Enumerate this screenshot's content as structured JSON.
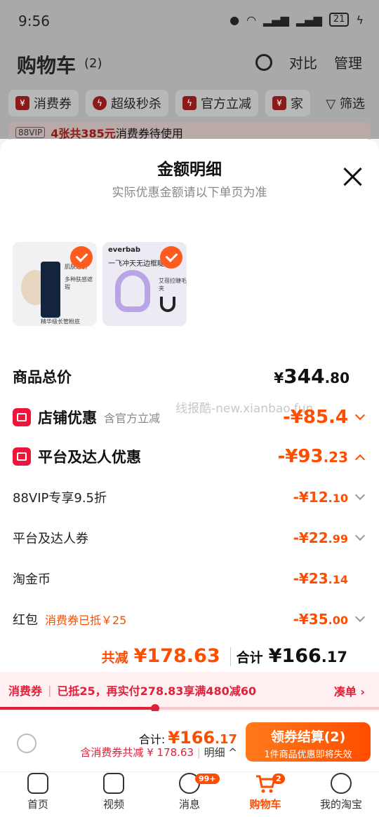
{
  "status_bar": {
    "time": "9:56",
    "network": "6",
    "battery": "21"
  },
  "background": {
    "title": "购物车",
    "count": "(2)",
    "actions": [
      "对比",
      "管理"
    ],
    "chips": [
      {
        "label": "消费券",
        "icon": "coupon-icon"
      },
      {
        "label": "超级秒杀",
        "icon": "lightning-icon"
      },
      {
        "label": "官方立减",
        "icon": "lightning-icon"
      },
      {
        "label": "家",
        "icon": "coupon-icon"
      }
    ],
    "filter_label": "筛选",
    "banner": {
      "vip": "88VIP",
      "highlight": "4张共385元",
      "text": "消费券待使用"
    }
  },
  "sheet": {
    "title": "金额明细",
    "subtitle": "实际优惠金额请以下单页为准",
    "products": [
      {
        "brand": "肌肤之钥",
        "slogan": "多种肤感遮瑕",
        "text": "精华级长管粉底"
      },
      {
        "brand": "everbab",
        "slogan": "一飞冲天无边框睫",
        "text": "艾蓓拉睫毛夹"
      }
    ],
    "total_goods": {
      "label": "商品总价",
      "currency": "¥",
      "int": "344",
      "dec": ".80"
    },
    "shop_discount": {
      "label": "店铺优惠",
      "note": "含官方立减",
      "value": "-¥85.4"
    },
    "platform_discount": {
      "label": "平台及达人优惠",
      "value_int": "-¥93",
      "value_dec": ".23"
    },
    "details": [
      {
        "label": "88VIP专享9.5折",
        "int": "-¥12",
        "dec": ".10",
        "has_chevron": true
      },
      {
        "label": "平台及达人券",
        "int": "-¥22",
        "dec": ".99",
        "has_chevron": true
      },
      {
        "label": "淘金币",
        "int": "-¥23",
        "dec": ".14",
        "has_chevron": false
      },
      {
        "label": "红包",
        "note": "消费券已抵￥25",
        "int": "-¥35",
        "dec": ".00",
        "has_chevron": true
      }
    ],
    "watermark": "线报酷-new.xianbao.fun",
    "total_reduce_label": "共减",
    "total_reduce": "¥178.63",
    "total_sum_label": "合计",
    "total_sum_int": "¥166",
    "total_sum_dec": ".17"
  },
  "coupon_strip": {
    "label": "消费券",
    "text": "已抵25，再实付278.83享满480减60",
    "action": "凑单",
    "progress": 0.41
  },
  "checkout": {
    "total_label": "合计:",
    "total_int": "¥166",
    "total_dec": ".17",
    "sub": "含消费券共减 ¥ 178.63",
    "detail_link": "明细",
    "button_main": "领券结算(2)",
    "button_sub": "1件商品优惠即将失效"
  },
  "tabbar": [
    {
      "label": "首页",
      "icon": "home-icon"
    },
    {
      "label": "视频",
      "icon": "video-icon"
    },
    {
      "label": "消息",
      "icon": "message-icon",
      "badge": "99+"
    },
    {
      "label": "购物车",
      "icon": "cart-icon",
      "badge": "2",
      "active": true
    },
    {
      "label": "我的淘宝",
      "icon": "profile-icon"
    }
  ],
  "colors": {
    "accent": "#ff4d00",
    "coupon_red": "#e0203a",
    "badge_red": "#f0143d"
  }
}
